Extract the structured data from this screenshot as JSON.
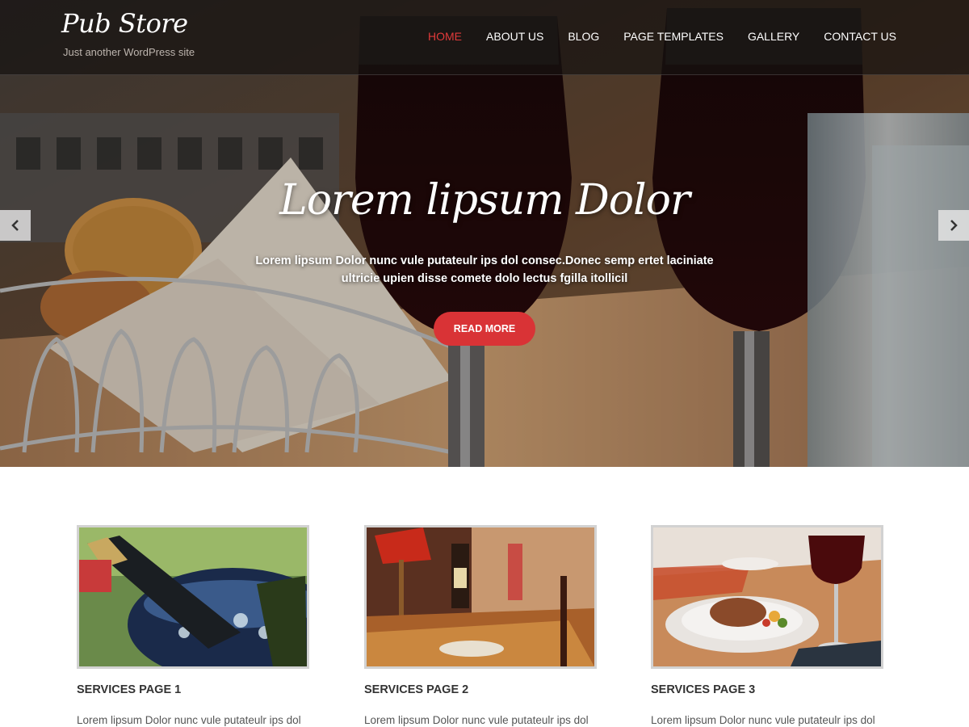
{
  "site": {
    "title": "Pub Store",
    "tagline": "Just another WordPress site"
  },
  "nav": {
    "items": [
      "HOME",
      "ABOUT US",
      "BLOG",
      "PAGE TEMPLATES",
      "GALLERY",
      "CONTACT US"
    ],
    "active_index": 0
  },
  "slider": {
    "title": "Lorem lipsum Dolor",
    "text": "Lorem lipsum Dolor nunc vule putateulr ips dol consec.Donec semp ertet laciniate ultricie upien disse comete dolo lectus fgilla itollicil",
    "button": "READ MORE",
    "prev_icon": "chevron-left-icon",
    "next_icon": "chevron-right-icon"
  },
  "services": [
    {
      "title": "SERVICES PAGE 1",
      "text": "Lorem lipsum Dolor nunc vule putateulr ips dol"
    },
    {
      "title": "SERVICES PAGE 2",
      "text": "Lorem lipsum Dolor nunc vule putateulr ips dol"
    },
    {
      "title": "SERVICES PAGE 3",
      "text": "Lorem lipsum Dolor nunc vule putateulr ips dol"
    }
  ],
  "colors": {
    "accent": "#d93336",
    "nav_active": "#e03a3a"
  }
}
